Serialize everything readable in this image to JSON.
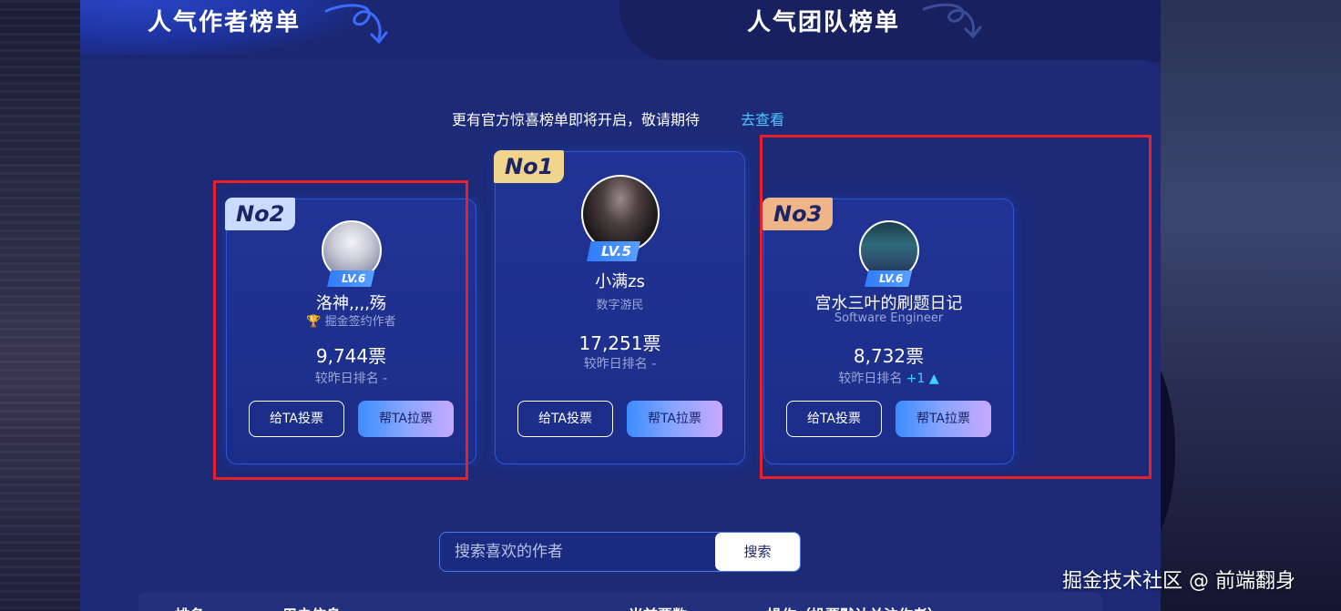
{
  "header": {
    "left_title": "人气作者榜单",
    "right_title": "人气团队榜单"
  },
  "notice": {
    "text": "更有官方惊喜榜单即将开启，敬请期待",
    "link": "去查看"
  },
  "cards": [
    {
      "rank": "No2",
      "level": "LV.6",
      "name": "洛神,,,,殇",
      "subtitle": "掘金签约作者",
      "votes": "9,744票",
      "rank_change_label": "较昨日排名",
      "rank_change_value": "-",
      "vote_button": "给TA投票",
      "canvass_button": "帮TA拉票",
      "tag_color": "#c9dbff"
    },
    {
      "rank": "No1",
      "level": "LV.5",
      "name": "小满zs",
      "subtitle": "数字游民",
      "votes": "17,251票",
      "rank_change_label": "较昨日排名",
      "rank_change_value": "-",
      "vote_button": "给TA投票",
      "canvass_button": "帮TA拉票",
      "tag_color": "#f1d48c"
    },
    {
      "rank": "No3",
      "level": "LV.6",
      "name": "宫水三叶的刷题日记",
      "subtitle": "Software Engineer",
      "votes": "8,732票",
      "rank_change_label": "较昨日排名",
      "rank_change_value": "+1",
      "vote_button": "给TA投票",
      "canvass_button": "帮TA拉票",
      "tag_color": "#f0b489"
    }
  ],
  "search": {
    "placeholder": "搜索喜欢的作者",
    "button": "搜索"
  },
  "table_headers": [
    "排名",
    "用户信息",
    "当前票数",
    "操作（投票默认关注作者）"
  ],
  "watermark": "掘金技术社区 @ 前端翻身"
}
